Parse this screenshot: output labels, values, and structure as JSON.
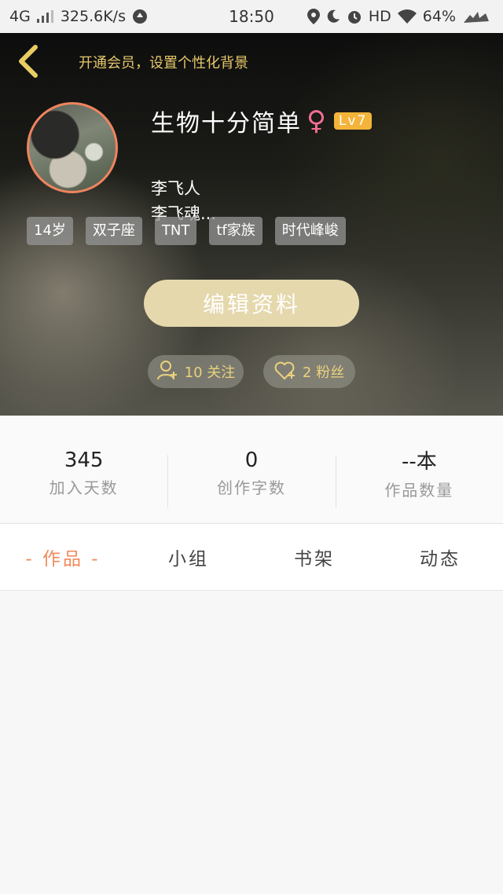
{
  "status_bar": {
    "network": "4G",
    "speed": "325.6K/s",
    "time": "18:50",
    "hd_label": "HD",
    "battery": "64%"
  },
  "header": {
    "vip_text": "开通会员，设置个性化背景"
  },
  "profile": {
    "name": "生物十分简单",
    "gender_symbol": "♀",
    "level": "Lv7",
    "bio_line1": "李飞人",
    "bio_line2": "李飞魂...",
    "tags": [
      "14岁",
      "双子座",
      "TNT",
      "tf家族",
      "时代峰峻"
    ],
    "edit_label": "编辑资料",
    "follow_label": "10 关注",
    "fans_label": "2 粉丝"
  },
  "stats": [
    {
      "value": "345",
      "label": "加入天数"
    },
    {
      "value": "0",
      "label": "创作字数"
    },
    {
      "value": "--本",
      "label": "作品数量"
    }
  ],
  "tabs": [
    {
      "label": "- 作品 -",
      "active": true
    },
    {
      "label": "小组",
      "active": false
    },
    {
      "label": "书架",
      "active": false
    },
    {
      "label": "动态",
      "active": false
    }
  ],
  "colors": {
    "accent": "#f08a59",
    "gold": "#e6c86a",
    "level_badge": "#f4b43a",
    "edit_button": "#e5d8ad"
  }
}
